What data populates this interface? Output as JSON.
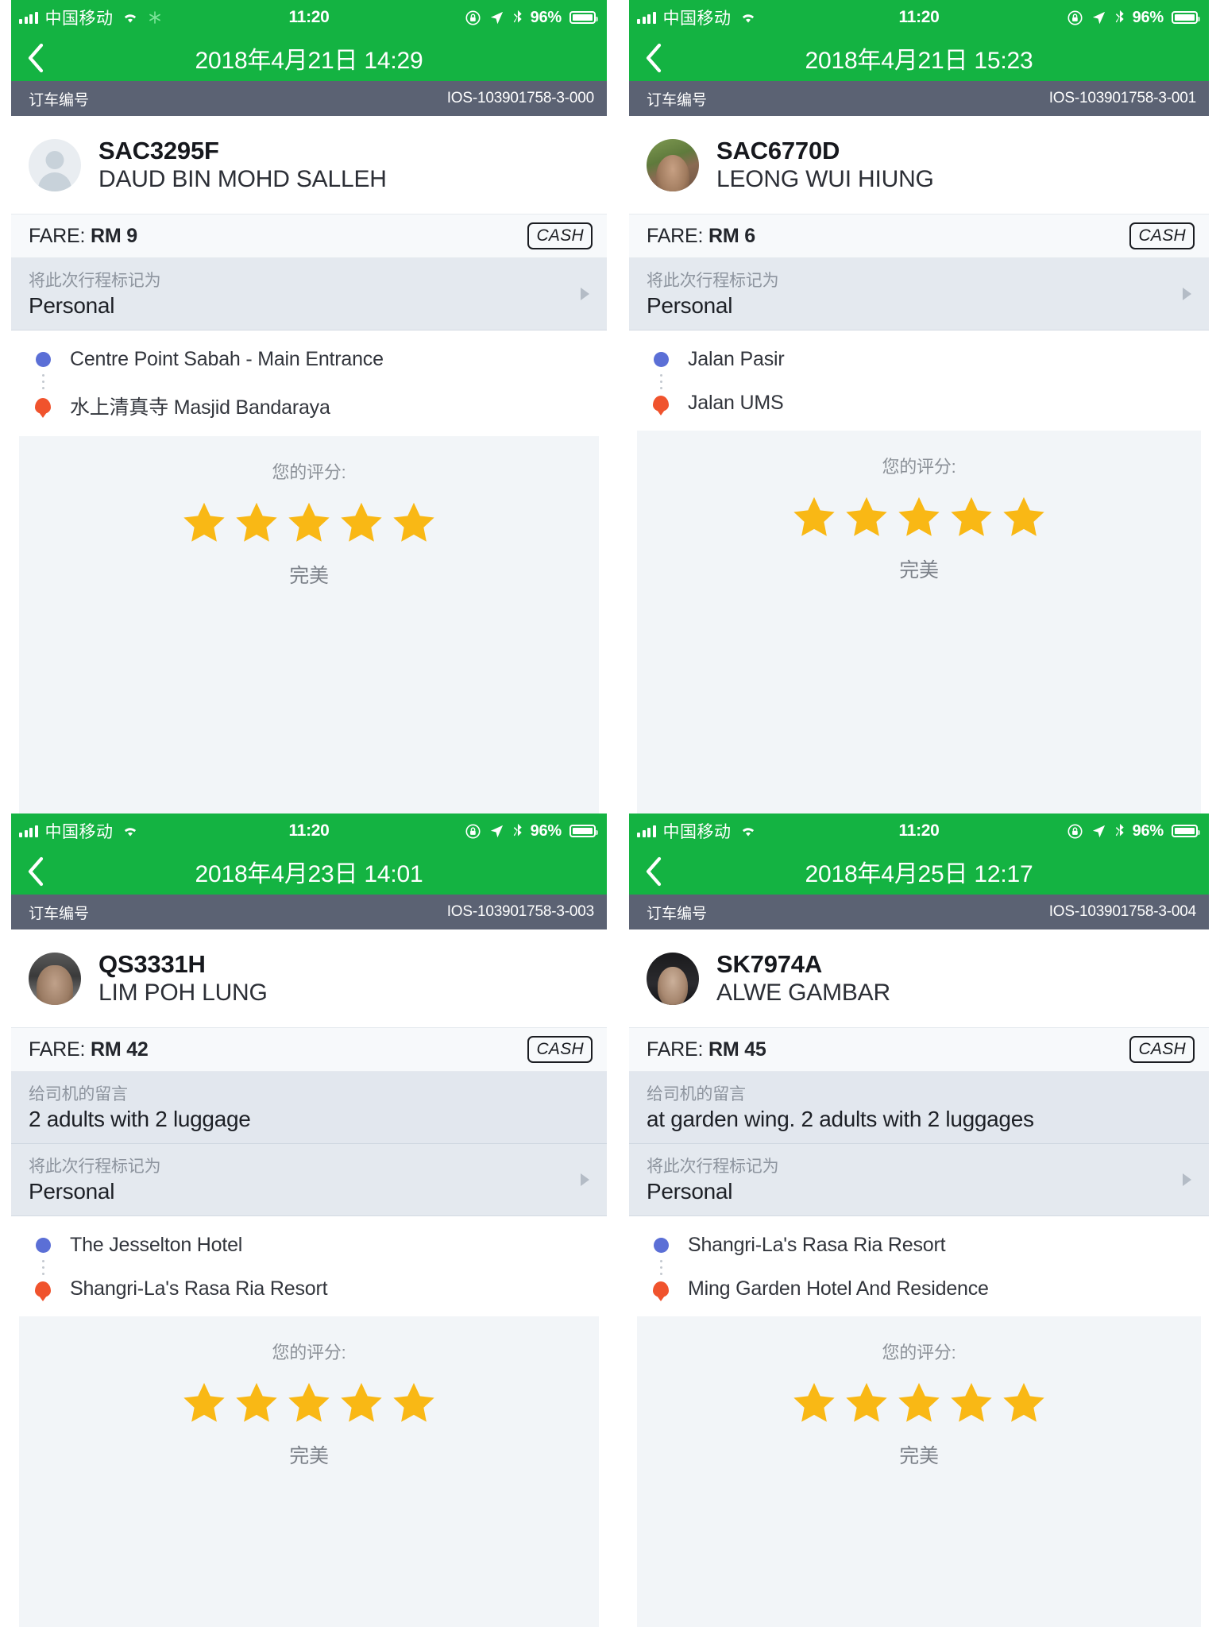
{
  "app": {
    "accent_green": "#14b342",
    "orderbar_gray": "#5b6273",
    "star_color": "#f9b815",
    "start_dot_color": "#5b6fd6",
    "end_pin_color": "#f0532d"
  },
  "status_bar": {
    "carrier": "中国移动",
    "time": "11:20",
    "battery_percent": "96%",
    "icons": [
      "signal-bars-icon",
      "wifi-icon",
      "snowflake-icon",
      "rotation-lock-icon",
      "location-arrow-icon",
      "bluetooth-icon",
      "battery-icon"
    ]
  },
  "labels": {
    "order_number": "订车编号",
    "fare_prefix": "FARE:",
    "payment_method": "CASH",
    "trip_tag_label": "将此次行程标记为",
    "message_label": "给司机的留言",
    "rating_title": "您的评分:",
    "rating_word": "完美"
  },
  "panels": [
    {
      "id": "panel-1",
      "has_snowflake": true,
      "nav_title": "2018年4月21日 14:29",
      "order_id": "IOS-103901758-3-000",
      "driver": {
        "plate": "SAC3295F",
        "name": "DAUD BIN MOHD SALLEH",
        "avatar": "placeholder-avatar"
      },
      "fare": "RM 9",
      "payment": "CASH",
      "message": null,
      "trip_tag": "Personal",
      "pickup": "Centre Point Sabah - Main Entrance",
      "dropoff": "水上清真寺 Masjid Bandaraya",
      "rating": 5
    },
    {
      "id": "panel-2",
      "has_snowflake": false,
      "nav_title": "2018年4月21日 15:23",
      "order_id": "IOS-103901758-3-001",
      "driver": {
        "plate": "SAC6770D",
        "name": "LEONG WUI HIUNG",
        "avatar": "photo-avatar"
      },
      "fare": "RM 6",
      "payment": "CASH",
      "message": null,
      "trip_tag": "Personal",
      "pickup": "Jalan Pasir",
      "dropoff": "Jalan UMS",
      "rating": 5
    },
    {
      "id": "panel-3",
      "has_snowflake": false,
      "nav_title": "2018年4月23日 14:01",
      "order_id": "IOS-103901758-3-003",
      "driver": {
        "plate": "QS3331H",
        "name": "LIM POH LUNG",
        "avatar": "photo-avatar"
      },
      "fare": "RM 42",
      "payment": "CASH",
      "message": "2 adults with 2 luggage",
      "trip_tag": "Personal",
      "pickup": "The Jesselton Hotel",
      "dropoff": "Shangri-La's Rasa Ria Resort",
      "rating": 5
    },
    {
      "id": "panel-4",
      "has_snowflake": false,
      "nav_title": "2018年4月25日 12:17",
      "order_id": "IOS-103901758-3-004",
      "driver": {
        "plate": "SK7974A",
        "name": "ALWE GAMBAR",
        "avatar": "photo-avatar"
      },
      "fare": "RM 45",
      "payment": "CASH",
      "message": "at garden wing. 2 adults with 2 luggages",
      "trip_tag": "Personal",
      "pickup": "Shangri-La's Rasa Ria Resort",
      "dropoff": "Ming Garden Hotel And Residence",
      "rating": 5
    }
  ]
}
